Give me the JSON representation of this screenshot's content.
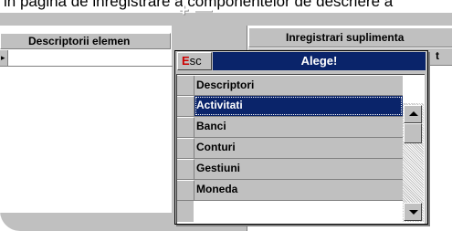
{
  "page_top_fragment": "in pagina de inregistrare a componentelor de descriere a",
  "left_table": {
    "column_header": "Descriptorii elemen",
    "row_marker": "▸"
  },
  "toolbar": {
    "add_icon": "plus-icon",
    "add_label": "+",
    "remove_icon": "minus-icon",
    "remove_label": "—"
  },
  "right_panel": {
    "header": "Inregistrari suplimenta",
    "subheader_fragment": "t"
  },
  "popup": {
    "esc_first_letter": "E",
    "esc_rest": "sc",
    "title": "Alege!",
    "list_header": "Descriptori",
    "items": [
      {
        "label": "Activitati",
        "selected": true
      },
      {
        "label": "Banci",
        "selected": false
      },
      {
        "label": "Conturi",
        "selected": false
      },
      {
        "label": "Gestiuni",
        "selected": false
      },
      {
        "label": "Moneda",
        "selected": false
      }
    ]
  },
  "colors": {
    "selection": "#0a246a",
    "face": "#c0c0c0",
    "esc_accent": "#cc0000"
  }
}
